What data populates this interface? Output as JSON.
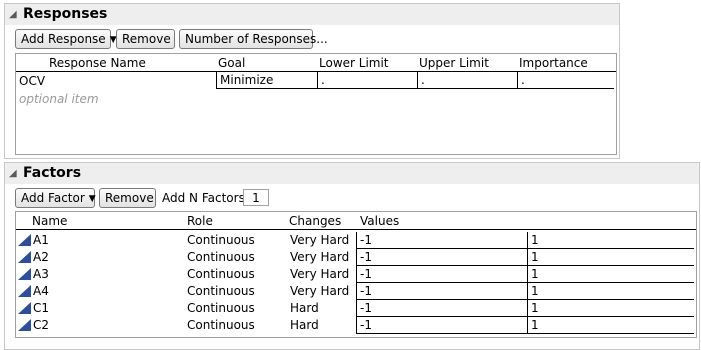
{
  "responses": {
    "title": "Responses",
    "buttons": {
      "add_response": "Add Response",
      "remove": "Remove",
      "number_of_responses": "Number of Responses..."
    },
    "columns": [
      "Response Name",
      "Goal",
      "Lower Limit",
      "Upper Limit",
      "Importance"
    ],
    "rows": [
      {
        "name": "OCV",
        "goal": "Minimize",
        "lower": ".",
        "upper": ".",
        "importance": "."
      }
    ],
    "placeholder": "optional item"
  },
  "factors": {
    "title": "Factors",
    "buttons": {
      "add_factor": "Add Factor",
      "remove": "Remove",
      "add_n_factors_label": "Add N Factors",
      "add_n_factors_value": "1"
    },
    "columns": [
      "Name",
      "Role",
      "Changes",
      "Values"
    ],
    "rows": [
      {
        "name": "A1",
        "role": "Continuous",
        "changes": "Very Hard",
        "low": "-1",
        "high": "1"
      },
      {
        "name": "A2",
        "role": "Continuous",
        "changes": "Very Hard",
        "low": "-1",
        "high": "1"
      },
      {
        "name": "A3",
        "role": "Continuous",
        "changes": "Very Hard",
        "low": "-1",
        "high": "1"
      },
      {
        "name": "A4",
        "role": "Continuous",
        "changes": "Very Hard",
        "low": "-1",
        "high": "1"
      },
      {
        "name": "C1",
        "role": "Continuous",
        "changes": "Hard",
        "low": "-1",
        "high": "1"
      },
      {
        "name": "C2",
        "role": "Continuous",
        "changes": "Hard",
        "low": "-1",
        "high": "1"
      }
    ]
  },
  "icons": {
    "outline_toggle": "disclosure-triangle-icon",
    "factor_type": "continuous-factor-icon"
  },
  "colors": {
    "factor_icon": "#2e4e9a",
    "placeholder_text": "#9a9a9a"
  }
}
